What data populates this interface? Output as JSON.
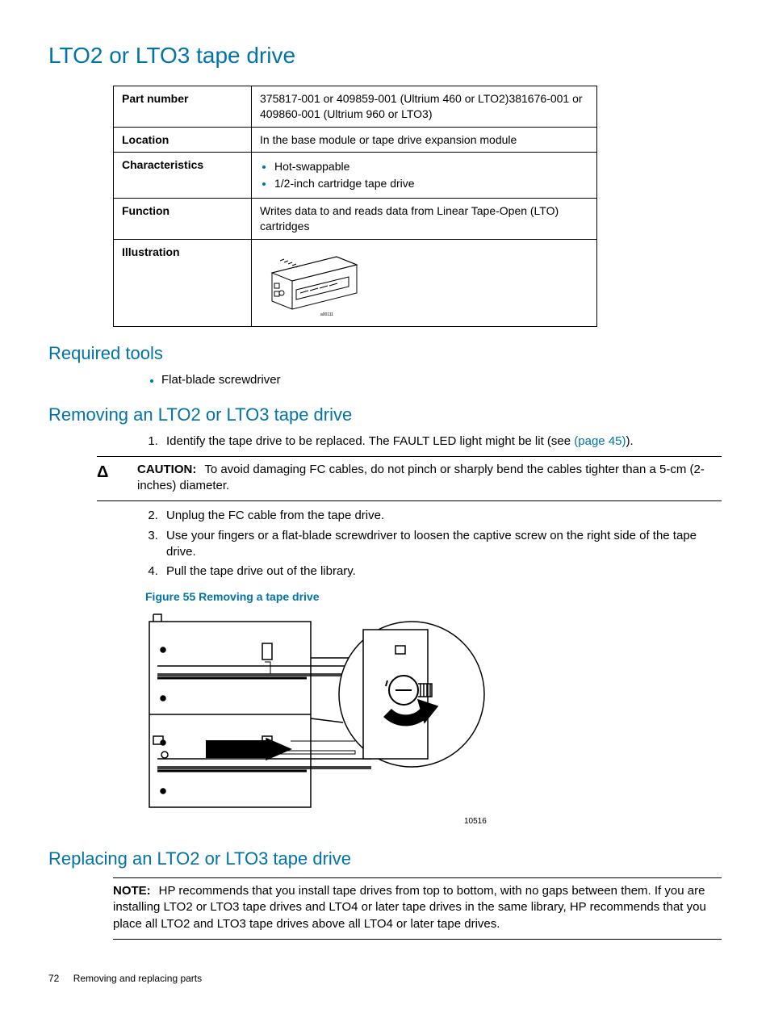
{
  "headings": {
    "h1": "LTO2 or LTO3 tape drive",
    "required_tools": "Required tools",
    "removing": "Removing an LTO2 or LTO3 tape drive",
    "replacing": "Replacing an LTO2 or LTO3 tape drive"
  },
  "spec_table": {
    "rows": [
      {
        "label": "Part number",
        "value": "375817-001 or 409859-001 (Ultrium 460 or LTO2)381676-001 or 409860-001 (Ultrium 960 or LTO3)"
      },
      {
        "label": "Location",
        "value": "In the base module or tape drive expansion module"
      },
      {
        "label": "Characteristics",
        "bullets": [
          "Hot-swappable",
          "1/2-inch cartridge tape drive"
        ]
      },
      {
        "label": "Function",
        "value": "Writes data to and reads data from Linear Tape-Open (LTO) cartridges"
      },
      {
        "label": "Illustration",
        "image": true
      }
    ]
  },
  "tools": [
    "Flat-blade screwdriver"
  ],
  "steps_pre": {
    "1": {
      "text_before": "Identify the tape drive to be replaced. The FAULT LED light might be lit (see ",
      "link": "(page 45)",
      "text_after": ")."
    }
  },
  "caution": {
    "icon": "Δ",
    "label": "CAUTION:",
    "text": "To avoid damaging FC cables, do not pinch or sharply bend the cables tighter than a 5-cm (2-inches) diameter."
  },
  "steps_post": {
    "2": "Unplug the FC cable from the tape drive.",
    "3": "Use your fingers or a flat-blade screwdriver to loosen the captive screw on the right side of the tape drive.",
    "4": "Pull the tape drive out of the library."
  },
  "figure": {
    "caption": "Figure 55 Removing a tape drive",
    "ref": "10516"
  },
  "note": {
    "label": "NOTE:",
    "text": "HP recommends that you install tape drives from top to bottom, with no gaps between them. If you are installing LTO2 or LTO3 tape drives and LTO4 or later tape drives in the same library, HP recommends that you place all LTO2 and LTO3 tape drives above all LTO4 or later tape drives."
  },
  "footer": {
    "page": "72",
    "section": "Removing and replacing parts"
  }
}
